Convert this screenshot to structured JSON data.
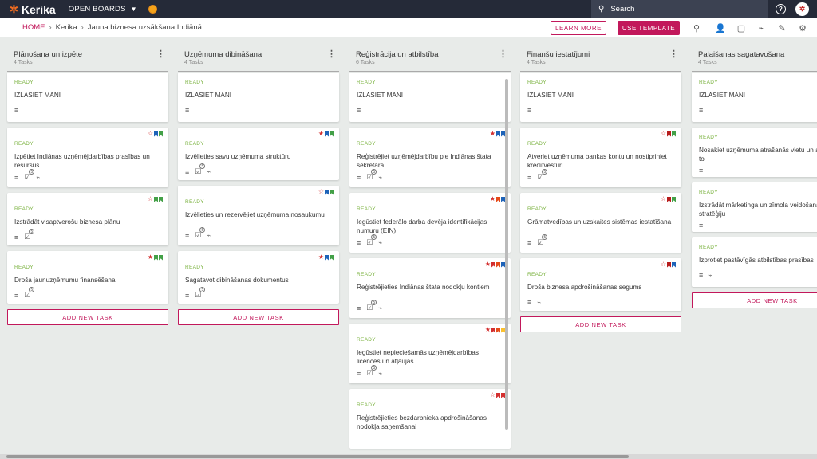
{
  "app": {
    "logo_text": "Kerika",
    "open_boards": "OPEN BOARDS"
  },
  "search": {
    "placeholder": "Search"
  },
  "breadcrumb": {
    "home": "HOME",
    "org": "Kerika",
    "board": "Jauna biznesa uzsākšana Indiānā"
  },
  "actions": {
    "learn_more": "LEARN MORE",
    "use_template": "USE TEMPLATE"
  },
  "colors": {
    "accent": "#c2185b",
    "topbar": "#252a38",
    "ready": "#7cb342"
  },
  "columns": [
    {
      "title": "Plānošana un izpēte",
      "count": "4 Tasks",
      "cards": [
        {
          "status": "READY",
          "title": "IZLASIET MANI",
          "desc": true,
          "checklist": null,
          "attach": false,
          "flags": []
        },
        {
          "status": "READY",
          "title": "Izpētiet Indiānas uzņēmējdarbības prasības un resursus",
          "desc": true,
          "checklist": "5",
          "attach": true,
          "flags": [
            "star-empty",
            "#1e63b8",
            "#43a047"
          ]
        },
        {
          "status": "READY",
          "title": "Izstrādāt visaptverošu biznesa plānu",
          "desc": true,
          "checklist": "5",
          "attach": false,
          "flags": [
            "star-empty",
            "#43a047",
            "#43a047"
          ]
        },
        {
          "status": "READY",
          "title": "Droša jaunuzņēmumu finansēšana",
          "desc": true,
          "checklist": "5",
          "attach": false,
          "flags": [
            "star-filled",
            "#43a047",
            "#43a047"
          ]
        }
      ],
      "add_label": "ADD NEW TASK"
    },
    {
      "title": "Uzņēmuma dibināšana",
      "count": "4 Tasks",
      "cards": [
        {
          "status": "READY",
          "title": "IZLASIET MANI",
          "desc": true,
          "checklist": null,
          "attach": false,
          "flags": []
        },
        {
          "status": "READY",
          "title": "Izvēlieties savu uzņēmuma struktūru",
          "desc": true,
          "checklist": "5",
          "attach": true,
          "flags": [
            "star-filled",
            "#1e63b8",
            "#43a047"
          ]
        },
        {
          "status": "READY",
          "title": "Izvēlieties un rezervējiet uzņēmuma nosaukumu",
          "desc": true,
          "checklist": "5",
          "attach": true,
          "flags": [
            "star-empty",
            "#1e63b8",
            "#43a047"
          ]
        },
        {
          "status": "READY",
          "title": "Sagatavot dibināšanas dokumentus",
          "desc": true,
          "checklist": "5",
          "attach": false,
          "flags": [
            "star-filled",
            "#1e63b8",
            "#43a047"
          ]
        }
      ],
      "add_label": "ADD NEW TASK"
    },
    {
      "title": "Reģistrācija un atbilstība",
      "count": "6 Tasks",
      "cards": [
        {
          "status": "READY",
          "title": "IZLASIET MANI",
          "desc": true,
          "checklist": null,
          "attach": false,
          "flags": []
        },
        {
          "status": "READY",
          "title": "Reģistrējiet uzņēmējdarbību pie Indiānas štata sekretāra",
          "desc": true,
          "checklist": "5",
          "attach": true,
          "flags": [
            "star-filled",
            "#1e63b8",
            "#1e63b8"
          ]
        },
        {
          "status": "READY",
          "title": "Iegūstiet federālo darba devēja identifikācijas numuru (EIN)",
          "desc": true,
          "checklist": "5",
          "attach": true,
          "flags": [
            "star-filled",
            "#e64a19",
            "#1e63b8"
          ]
        },
        {
          "status": "READY",
          "title": "Reģistrējieties Indiānas štata nodokļu kontiem",
          "desc": true,
          "checklist": "5",
          "attach": true,
          "flags": [
            "star-filled",
            "#d32f2f",
            "#e64a19",
            "#1e63b8"
          ]
        },
        {
          "status": "READY",
          "title": "Iegūstiet nepieciešamās uzņēmējdarbības licences un atļaujas",
          "desc": true,
          "checklist": "5",
          "attach": true,
          "flags": [
            "star-filled",
            "#d32f2f",
            "#e64a19",
            "#fbc02d"
          ]
        },
        {
          "status": "READY",
          "title": "Reģistrējieties bezdarbnieka apdrošināšanas nodokļa saņemšanai",
          "desc": false,
          "checklist": null,
          "attach": false,
          "flags": [
            "star-empty",
            "#d32f2f",
            "#d32f2f"
          ]
        }
      ],
      "add_label": "ADD NEW TASK"
    },
    {
      "title": "Finanšu iestatījumi",
      "count": "4 Tasks",
      "cards": [
        {
          "status": "READY",
          "title": "IZLASIET MANI",
          "desc": true,
          "checklist": null,
          "attach": false,
          "flags": []
        },
        {
          "status": "READY",
          "title": "Atveriet uzņēmuma bankas kontu un nostipriniet kredītvēsturi",
          "desc": true,
          "checklist": "5",
          "attach": false,
          "flags": [
            "star-empty",
            "#b71c1c",
            "#43a047"
          ]
        },
        {
          "status": "READY",
          "title": "Grāmatvedības un uzskaites sistēmas iestatīšana",
          "desc": true,
          "checklist": "5",
          "attach": false,
          "flags": [
            "star-empty",
            "#b71c1c",
            "#43a047"
          ]
        },
        {
          "status": "READY",
          "title": "Droša biznesa apdrošināšanas segums",
          "desc": true,
          "checklist": null,
          "attach": true,
          "flags": [
            "star-empty",
            "#b71c1c",
            "#1e63b8"
          ]
        }
      ],
      "add_label": "ADD NEW TASK"
    },
    {
      "title": "Palaišanas sagatavošana",
      "count": "4 Tasks",
      "cards": [
        {
          "status": "READY",
          "title": "IZLASIET MANI",
          "desc": true,
          "checklist": null,
          "attach": false,
          "flags": []
        },
        {
          "status": "READY",
          "title": "Nosakiet uzņēmuma atrašanās vietu un aprīkojiet to",
          "desc": true,
          "checklist": null,
          "attach": false,
          "flags": []
        },
        {
          "status": "READY",
          "title": "Izstrādāt mārketinga un zīmola veidošanas stratēģiju",
          "desc": true,
          "checklist": null,
          "attach": false,
          "flags": []
        },
        {
          "status": "READY",
          "title": "Izprotiet pastāvīgās atbilstības prasības",
          "desc": true,
          "checklist": null,
          "attach": true,
          "flags": []
        }
      ],
      "add_label": "ADD NEW TASK"
    }
  ]
}
